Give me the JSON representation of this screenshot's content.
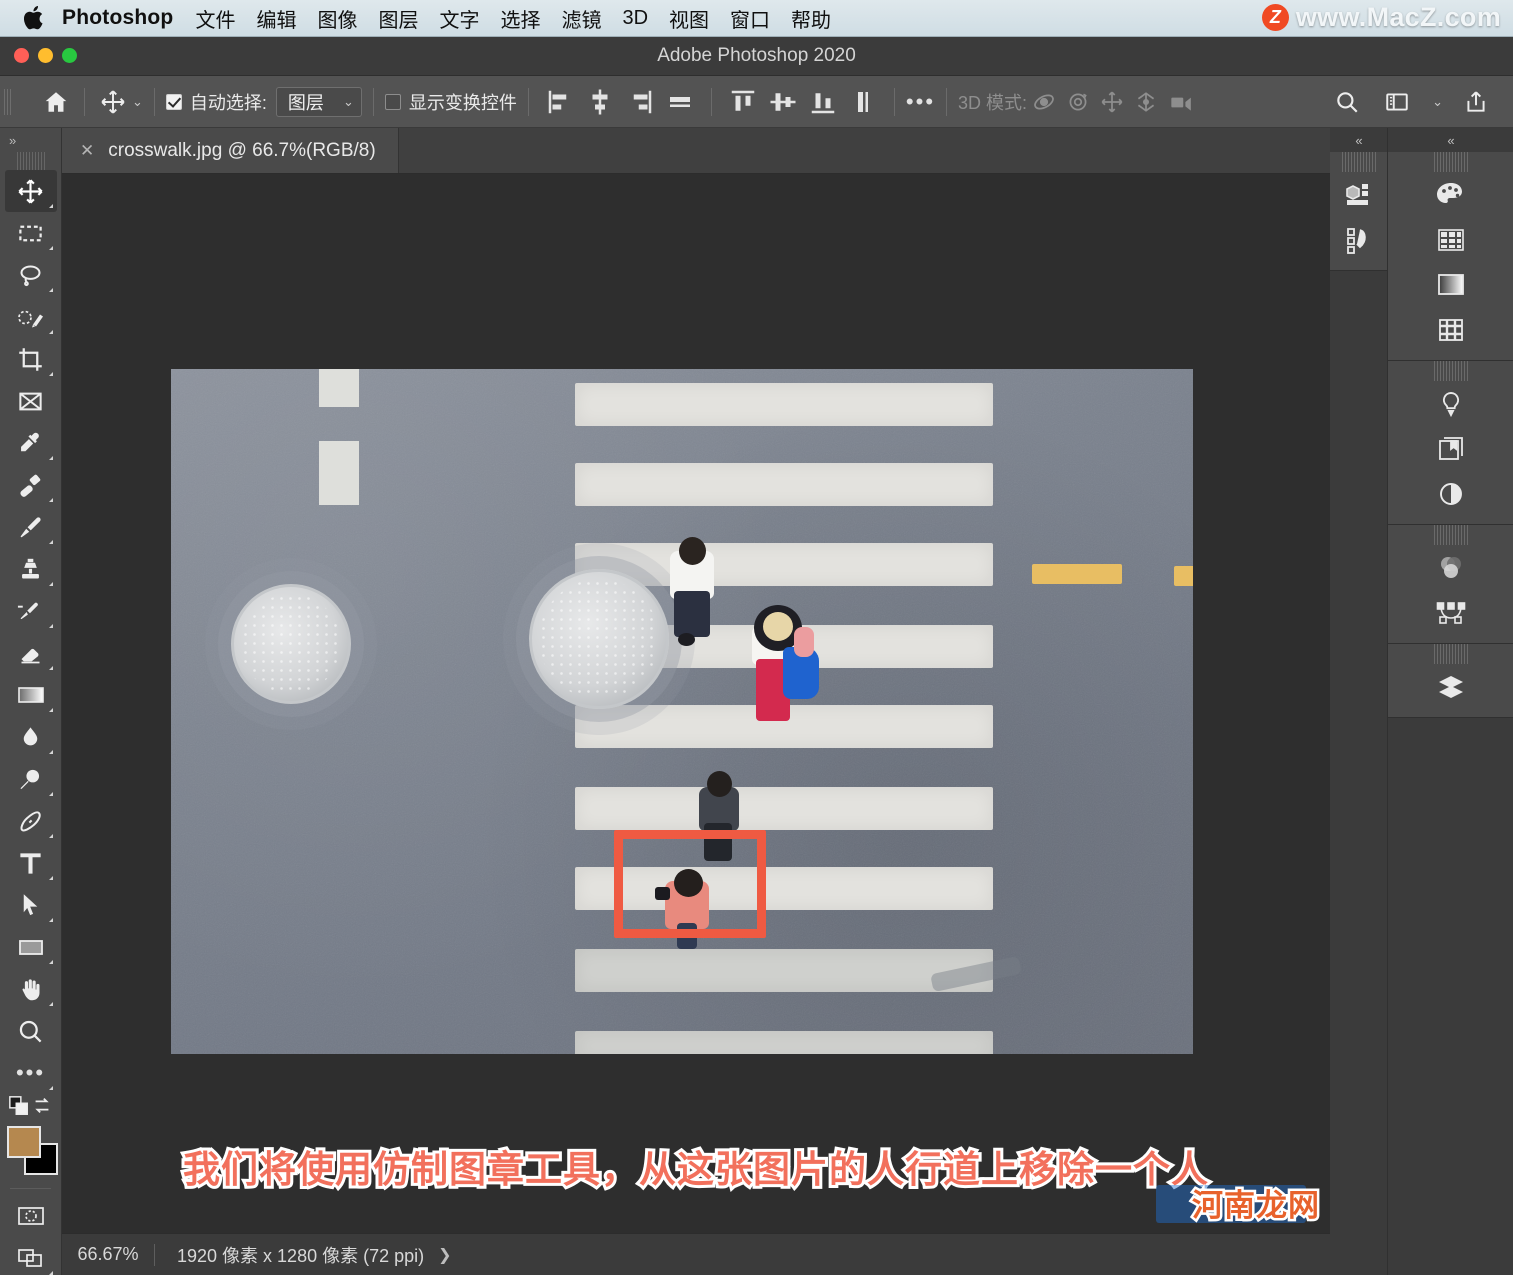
{
  "macbar": {
    "apple_icon": "apple-logo-icon",
    "app_name": "Photoshop",
    "menus": [
      "文件",
      "编辑",
      "图像",
      "图层",
      "文字",
      "选择",
      "滤镜",
      "3D",
      "视图",
      "窗口",
      "帮助"
    ],
    "watermark": {
      "badge": "Z",
      "text": "www.MacZ.com"
    }
  },
  "titlebar": {
    "title": "Adobe Photoshop 2020"
  },
  "options_bar": {
    "home_icon": "home-icon",
    "tool_icon": "move-tool-icon",
    "auto_select_label": "自动选择:",
    "auto_select_checked": true,
    "auto_select_value": "图层",
    "show_transform_label": "显示变换控件",
    "show_transform_checked": false,
    "align_icons": [
      "align-left-edges-icon",
      "align-horizontal-centers-icon",
      "align-right-edges-icon",
      "distribute-horizontal-icon",
      "align-top-edges-icon",
      "align-vertical-centers-icon",
      "align-bottom-edges-icon",
      "distribute-vertical-icon"
    ],
    "more_icon": "more-options-icon",
    "mode_3d_label": "3D 模式:",
    "mode_3d_icons": [
      "3d-orbit-icon",
      "3d-roll-icon",
      "3d-pan-icon",
      "3d-slide-icon",
      "3d-camera-icon"
    ],
    "right_icons": [
      "search-icon",
      "workspace-icon",
      "chevron-down-icon",
      "share-icon"
    ]
  },
  "tabbar": {
    "close_glyph": "✕",
    "document_title": "crosswalk.jpg @ 66.7%(RGB/8)"
  },
  "left_toolbar": {
    "collapse_glyph": "»",
    "tools": [
      {
        "name": "move-tool",
        "active": true
      },
      {
        "name": "rectangular-marquee-tool",
        "active": false
      },
      {
        "name": "lasso-tool",
        "active": false
      },
      {
        "name": "object-selection-tool",
        "active": false
      },
      {
        "name": "crop-tool",
        "active": false
      },
      {
        "name": "frame-tool",
        "active": false
      },
      {
        "name": "eyedropper-tool",
        "active": false
      },
      {
        "name": "spot-healing-brush-tool",
        "active": false
      },
      {
        "name": "brush-tool",
        "active": false
      },
      {
        "name": "clone-stamp-tool",
        "active": false
      },
      {
        "name": "history-brush-tool",
        "active": false
      },
      {
        "name": "eraser-tool",
        "active": false
      },
      {
        "name": "gradient-tool",
        "active": false
      },
      {
        "name": "blur-tool",
        "active": false
      },
      {
        "name": "dodge-tool",
        "active": false
      },
      {
        "name": "pen-tool",
        "active": false
      },
      {
        "name": "type-tool",
        "active": false
      },
      {
        "name": "path-selection-tool",
        "active": false
      },
      {
        "name": "rectangle-tool",
        "active": false
      },
      {
        "name": "hand-tool",
        "active": false
      },
      {
        "name": "zoom-tool",
        "active": false
      },
      {
        "name": "edit-toolbar-tool",
        "active": false
      }
    ],
    "foreground_color": "#b5884f",
    "background_color": "#000000",
    "quickmask_icon": "quick-mask-icon",
    "screenmode_icon": "screen-mode-icon"
  },
  "right_dock": {
    "collapse_glyph_a": "«",
    "collapse_glyph_b": "«",
    "column_a_items": [
      "3d-panel-icon",
      "actions-panel-icon"
    ],
    "groups": [
      {
        "items": [
          "color-panel-icon",
          "swatches-panel-icon",
          "gradients-panel-icon",
          "patterns-panel-icon"
        ]
      },
      {
        "items": [
          "adjustments-panel-icon",
          "libraries-panel-icon",
          "properties-panel-icon"
        ]
      },
      {
        "items": [
          "channels-panel-icon",
          "paths-panel-icon"
        ]
      },
      {
        "items": [
          "layers-panel-icon"
        ]
      }
    ]
  },
  "canvas": {
    "photo_alt": "aerial-crosswalk-photo",
    "selection_box_color": "#ef5a42",
    "subtitle": "我们将使用仿制图章工具，从这张图片的人行道上移除一个人",
    "watermark_bottom": "河南龙网"
  },
  "status_bar": {
    "zoom": "66.67%",
    "dimensions": "1920 像素 x 1280 像素 (72 ppi)",
    "arrow_glyph": "❯"
  }
}
